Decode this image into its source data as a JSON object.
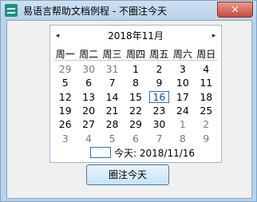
{
  "window": {
    "title": "易语言帮助文档例程 - 不圈注今天",
    "close_glyph": "✕",
    "icon": "app-icon"
  },
  "calendar": {
    "prev_glyph": "◂",
    "next_glyph": "▸",
    "month_label": "2018年11月",
    "weekdays": [
      "周一",
      "周二",
      "周三",
      "周四",
      "周五",
      "周六",
      "周日"
    ],
    "weeks": [
      [
        {
          "d": "29",
          "o": true
        },
        {
          "d": "30",
          "o": true
        },
        {
          "d": "31",
          "o": true
        },
        {
          "d": "1"
        },
        {
          "d": "2"
        },
        {
          "d": "3"
        },
        {
          "d": "4"
        }
      ],
      [
        {
          "d": "5"
        },
        {
          "d": "6"
        },
        {
          "d": "7"
        },
        {
          "d": "8"
        },
        {
          "d": "9"
        },
        {
          "d": "10"
        },
        {
          "d": "11"
        }
      ],
      [
        {
          "d": "12"
        },
        {
          "d": "13"
        },
        {
          "d": "14"
        },
        {
          "d": "15"
        },
        {
          "d": "16",
          "t": true
        },
        {
          "d": "17"
        },
        {
          "d": "18"
        }
      ],
      [
        {
          "d": "19"
        },
        {
          "d": "20"
        },
        {
          "d": "21"
        },
        {
          "d": "22"
        },
        {
          "d": "23"
        },
        {
          "d": "24"
        },
        {
          "d": "25"
        }
      ],
      [
        {
          "d": "26"
        },
        {
          "d": "27"
        },
        {
          "d": "28"
        },
        {
          "d": "29"
        },
        {
          "d": "30"
        },
        {
          "d": "1",
          "o": true
        },
        {
          "d": "2",
          "o": true
        }
      ],
      [
        {
          "d": "3",
          "o": true
        },
        {
          "d": "4",
          "o": true
        },
        {
          "d": "5",
          "o": true
        },
        {
          "d": "6",
          "o": true
        },
        {
          "d": "7",
          "o": true
        },
        {
          "d": "8",
          "o": true
        },
        {
          "d": "9",
          "o": true
        }
      ]
    ],
    "today_label": "今天: 2018/11/16"
  },
  "buttons": {
    "circle_today": "圈注今天"
  },
  "colors": {
    "today_border": "#3c6fb0",
    "other_month_text": "#7a7a7a"
  }
}
